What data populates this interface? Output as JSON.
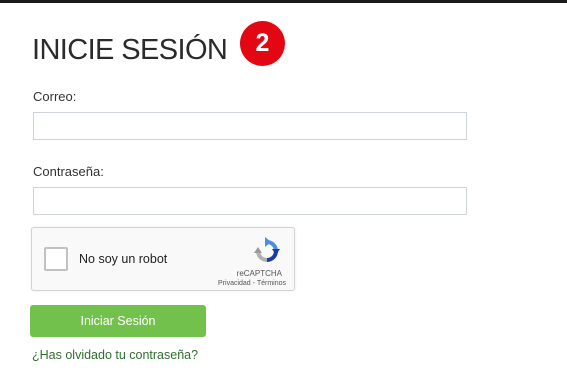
{
  "page": {
    "title": "INICIE SESIÓN",
    "step_badge": "2"
  },
  "form": {
    "email_label": "Correo:",
    "email_value": "",
    "password_label": "Contraseña:",
    "password_value": "",
    "submit_label": "Iniciar Sesión",
    "forgot_link": "¿Has olvidado tu contraseña?"
  },
  "captcha": {
    "checkbox_label": "No soy un robot",
    "checked": false,
    "brand": "reCAPTCHA",
    "privacy_link": "Privacidad",
    "separator": " - ",
    "terms_link": "Términos",
    "logo_icon": "recaptcha-logo"
  },
  "colors": {
    "badge": "#e30613",
    "button": "#72c14d",
    "link": "#2e6f2e"
  }
}
